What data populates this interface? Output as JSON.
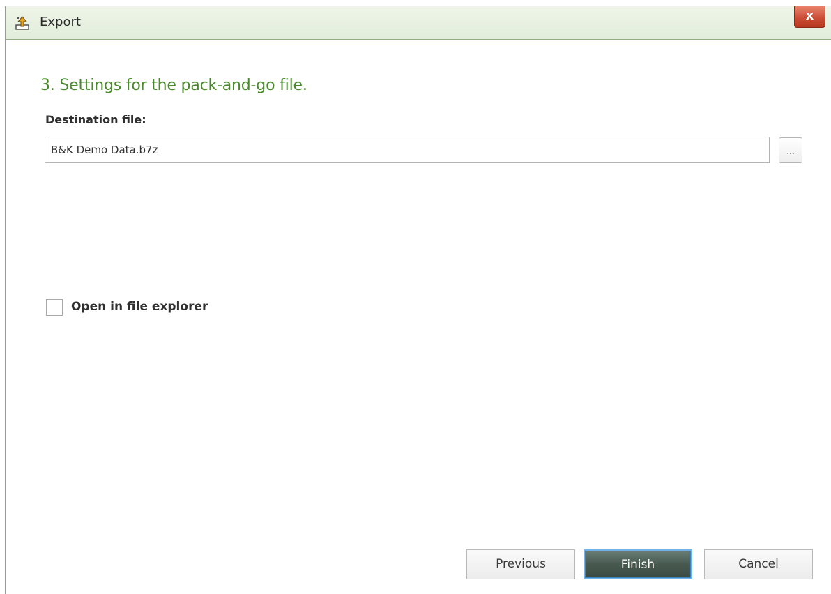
{
  "window": {
    "title": "Export",
    "title_icon": "export-icon",
    "close_label": "x"
  },
  "step": {
    "heading": "3. Settings for the pack-and-go file."
  },
  "destination": {
    "label": "Destination file:",
    "value": "B&K Demo Data.b7z",
    "browse_label": "..."
  },
  "options": {
    "open_in_explorer_label": "Open in file explorer",
    "open_in_explorer_checked": false
  },
  "buttons": {
    "previous_label": "Previous",
    "finish_label": "Finish",
    "cancel_label": "Cancel"
  },
  "colors": {
    "heading": "#4a8a2c",
    "titlebar": "#e2eddb",
    "finish_button": "#47594f",
    "close_button": "#c94a33"
  }
}
